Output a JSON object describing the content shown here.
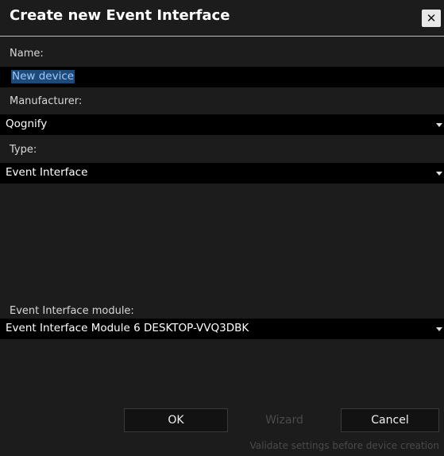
{
  "dialog": {
    "title": "Create new Event Interface",
    "close_icon": "close-icon"
  },
  "fields": {
    "name_label": "Name:",
    "name_value": "New device",
    "manufacturer_label": "Manufacturer:",
    "manufacturer_value": "Qognify",
    "type_label": "Type:",
    "type_value": "Event Interface",
    "module_label": "Event Interface module:",
    "module_value": "Event Interface Module 6 DESKTOP-VVQ3DBK"
  },
  "buttons": {
    "ok": "OK",
    "wizard": "Wizard",
    "cancel": "Cancel"
  },
  "hint": "Validate settings before device creation",
  "colors": {
    "background": "#1c1c1c",
    "input": "#000000",
    "selection": "#1e4a78",
    "disabled_text": "#4a4a4a"
  }
}
